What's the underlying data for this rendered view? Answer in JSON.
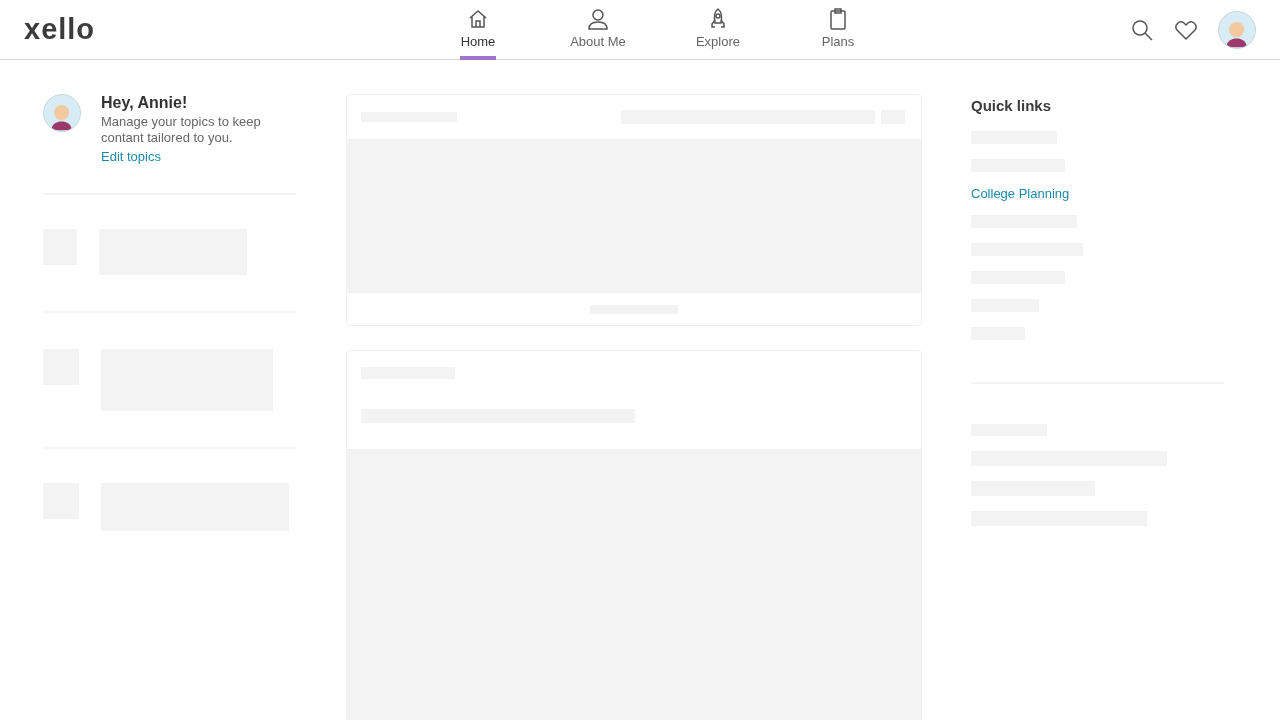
{
  "header": {
    "logo": "xello",
    "tabs": [
      {
        "label": "Home",
        "selected": true
      },
      {
        "label": "About Me",
        "selected": false
      },
      {
        "label": "Explore",
        "selected": false
      },
      {
        "label": "Plans",
        "selected": false
      }
    ]
  },
  "greeting": {
    "title": "Hey, Annie!",
    "message": "Manage your topics to keep contant tailored to you.",
    "link": "Edit topics"
  },
  "quick_links": {
    "title": "Quick links",
    "items": [
      {
        "kind": "placeholder"
      },
      {
        "kind": "placeholder"
      },
      {
        "kind": "link",
        "label": "College Planning"
      },
      {
        "kind": "placeholder"
      },
      {
        "kind": "placeholder"
      },
      {
        "kind": "placeholder"
      },
      {
        "kind": "placeholder"
      },
      {
        "kind": "placeholder"
      }
    ]
  }
}
